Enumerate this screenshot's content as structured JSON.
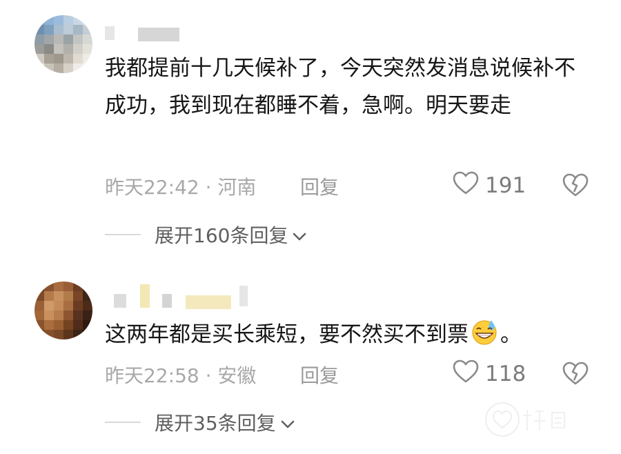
{
  "comments": [
    {
      "text": "我都提前十几天候补了，今天突然发消息说候补不成功，我到现在都睡不着，急啊。明天要走",
      "meta": "昨天22:42 · 河南",
      "reply_label": "回复",
      "likes": "191",
      "expand_label": "展开160条回复"
    },
    {
      "text": "这两年都是买长乘短，要不然买不到票",
      "text_suffix": "。",
      "emoji": "grinning-sweat-emoji",
      "meta": "昨天22:58 · 安徽",
      "reply_label": "回复",
      "likes": "118",
      "expand_label": "展开35条回复"
    }
  ],
  "icons": {
    "like": "heart-outline-icon",
    "dislike": "broken-heart-icon",
    "expand": "chevron-down-icon"
  },
  "colors": {
    "text": "#161616",
    "meta": "#a8a8a8",
    "action": "#7b7b7b"
  }
}
